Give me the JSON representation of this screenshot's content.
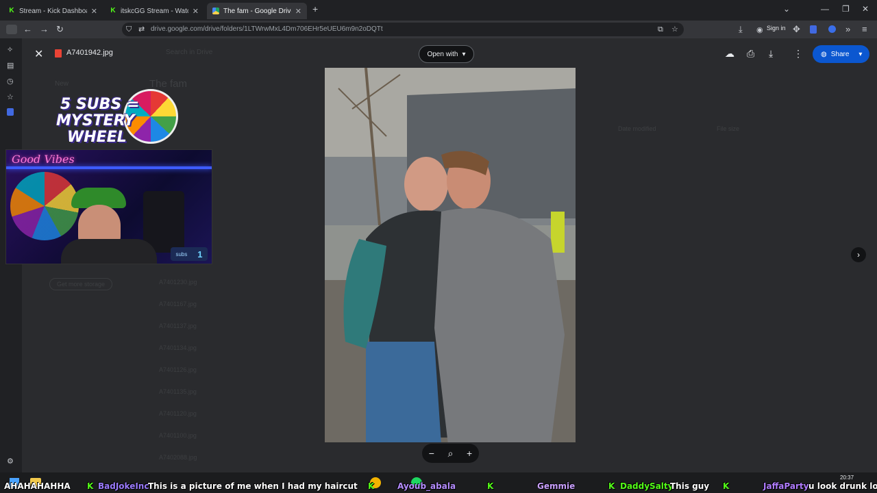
{
  "tabs": [
    {
      "label": "Stream - Kick Dashboard",
      "icon": "kick-icon"
    },
    {
      "label": "itskcGG Stream - Watch Live on",
      "icon": "kick-icon"
    },
    {
      "label": "The fam - Google Drive",
      "icon": "drive-icon"
    }
  ],
  "new_tab": "+",
  "address_bar": {
    "url": "drive.google.com/drive/folders/1LTWrwMxL4Dm706EHr5eUEU6m9n2oDQTt"
  },
  "sign_in": "Sign in",
  "viewer": {
    "file_name": "A7401942.jpg",
    "open_with": "Open with",
    "share": "Share"
  },
  "background_drive": {
    "search_placeholder": "Search in Drive",
    "folder_title": "The fam",
    "new_label": "New",
    "col_date": "Date modified",
    "col_size": "File size",
    "get_storage": "Get more storage",
    "files": [
      "A7401230.jpg",
      "A7401167.jpg",
      "A7401137.jpg",
      "A7401134.jpg",
      "A7401126.jpg",
      "A7401135.jpg",
      "A7401120.jpg",
      "A7401100.jpg",
      "A7402088.jpg"
    ]
  },
  "stream_overlay": {
    "wheel_line1": "5 SUBS =",
    "wheel_line2": "MYSTERY",
    "wheel_line3": "WHEEL",
    "neon_sign": "Good Vibes",
    "subs_label": "subs",
    "subs_count": "1"
  },
  "chat": [
    {
      "user": "",
      "msg": "AHAHAHAHHA",
      "color": "#ffffff"
    },
    {
      "user": "BadJokeInc",
      "msg": "This is a picture of me when I had my haircut",
      "color": "#9b7bff"
    },
    {
      "user": "Ayoub_abala",
      "msg": "",
      "color": "#b48cff"
    },
    {
      "user": "Gemmie",
      "msg": "",
      "color": "#c9a0ff"
    },
    {
      "user": "DaddySalty",
      "msg": "This guy",
      "color": "#53fc18"
    },
    {
      "user": "JaffaParty",
      "msg": "u look drunk lol",
      "color": "#b07cff"
    }
  ],
  "clock": {
    "time": "20:37"
  },
  "colors": {
    "kick": "#53fc18",
    "share_blue": "#0b57d0",
    "viewer_bg": "#2a2b2e"
  }
}
